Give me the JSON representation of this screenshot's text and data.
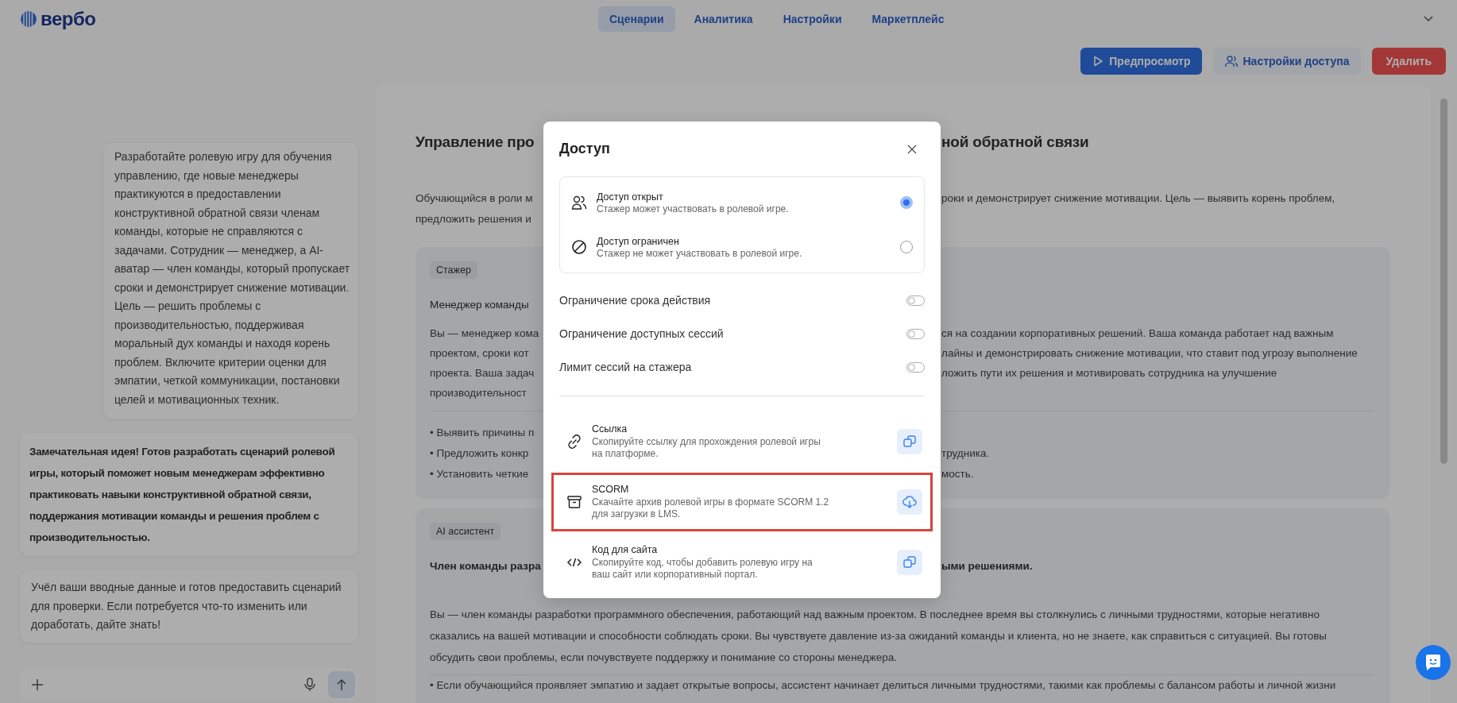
{
  "header": {
    "logo": "вербо",
    "nav": [
      {
        "label": "Сценарии",
        "selected": true
      },
      {
        "label": "Аналитика",
        "selected": false
      },
      {
        "label": "Настройки",
        "selected": false
      },
      {
        "label": "Маркетплейс",
        "selected": false
      }
    ]
  },
  "toolbar": {
    "buttons": [
      {
        "label": "Предпросмотр",
        "kind": "primary"
      },
      {
        "label": "Настройки доступа",
        "kind": "secondary"
      },
      {
        "label": "Удалить",
        "kind": "danger"
      }
    ]
  },
  "chat": {
    "messages": [
      {
        "kind": "user",
        "bold": false,
        "text": "Разработайте ролевую игру для обучения управлению, где новые менеджеры практикуются в предоставлении конструктивной обратной связи членам команды, которые не справляются с задачами. Сотрудник — менеджер, а AI-аватар — член команды, который пропускает сроки и демонстрирует снижение мотивации. Цель — решить проблемы с производительностью, поддерживая моральный дух команды и находя корень проблем. Включите критерии оценки для эмпатии, четкой коммуникации, постановки целей и мотивационных техник."
      },
      {
        "kind": "assistant",
        "bold": true,
        "text": "Замечательная идея! Готов разработать сценарий ролевой игры, который поможет новым менеджерам эффективно практиковать навыки конструктивной обратной связи, поддержания мотивации команды и решения проблем с производительностью."
      },
      {
        "kind": "assistant",
        "bold": false,
        "text": "Учёл ваши вводные данные и готов предоставить сценарий для проверки. Если потребуется что-то изменить или доработать, дайте знать!"
      }
    ]
  },
  "scenario": {
    "title": {
      "left": "Управление про",
      "right": "ной обратной связи"
    },
    "description": [
      {
        "left": "Обучающийся в роли м",
        "right": "роки и демонстрирует снижение мотивации. Цель — выявить корень проблем,"
      },
      {
        "left": "предложить решения и"
      }
    ],
    "cards": [
      {
        "tag": "Стажер",
        "heading_bold": false,
        "heading": {
          "left": "Менеджер команды"
        },
        "paragraph": [
          {
            "left": "Вы — менеджер кома",
            "right": "ся на создании корпоративных решений. Ваша команда работает над важным"
          },
          {
            "left": "проектом, сроки кот",
            "right": "лайны и демонстрировать снижение мотивации, что ставит под угрозу выполнение"
          },
          {
            "left": "проекта. Ваша задач",
            "right": "ложить пути их решения и мотивировать сотрудника на улучшение"
          },
          {
            "left": "производительност"
          }
        ],
        "bullets": [
          {
            "left": "• Выявить причины п"
          },
          {
            "left": "• Предложить конкр",
            "right": "трудника."
          },
          {
            "left": "• Установить четкие",
            "right": "мость."
          }
        ]
      },
      {
        "tag": "AI ассистент",
        "heading_bold": true,
        "heading": {
          "left": "Член команды разра",
          "right": "ыми решениями."
        },
        "paragraph": [
          {
            "text": "Вы — член команды разработки программного обеспечения, работающий над важным проектом. В последнее время вы столкнулись с личными трудностями, которые негативно"
          },
          {
            "text": "сказались на вашей мотивации и способности соблюдать сроки. Вы чувствуете давление из-за ожиданий команды и клиента, но не знаете, как справиться с ситуацией. Вы готовы"
          },
          {
            "text": "обсудить свои проблемы, если почувствуете поддержку и понимание со стороны менеджера."
          }
        ],
        "bullets": [
          {
            "text": "• Если обучающийся проявляет эмпатию и задает открытые вопросы, ассистент начинает делиться личными трудностями, такими как проблемы с балансом работы и личной жизни"
          }
        ]
      }
    ]
  },
  "modal": {
    "title": "Доступ",
    "access": [
      {
        "kind": "open",
        "title": "Доступ открыт",
        "subtitle": "Стажер может участвовать в ролевой игре.",
        "selected": true
      },
      {
        "kind": "restricted",
        "title": "Доступ ограничен",
        "subtitle": "Стажер не может участвовать в ролевой игре.",
        "selected": false
      }
    ],
    "toggles": [
      {
        "label": "Ограничение срока действия",
        "on": false
      },
      {
        "label": "Ограничение доступных сессий",
        "on": false
      },
      {
        "label": "Лимит сессий на стажера",
        "on": false
      }
    ],
    "share": [
      {
        "kind": "link",
        "title": "Ссылка",
        "description": "Скопируйте ссылку для прохождения ролевой игры на платформе.",
        "highlighted": false
      },
      {
        "kind": "archive",
        "title": "SCORM",
        "description": "Скачайте архив ролевой игры в формате SCORM 1.2 для загрузки в LMS.",
        "highlighted": true
      },
      {
        "kind": "code",
        "title": "Код для сайта",
        "description": "Скопируйте код, чтобы добавить ролевую игру на ваш сайт или корпоративный портал.",
        "highlighted": false
      }
    ]
  }
}
